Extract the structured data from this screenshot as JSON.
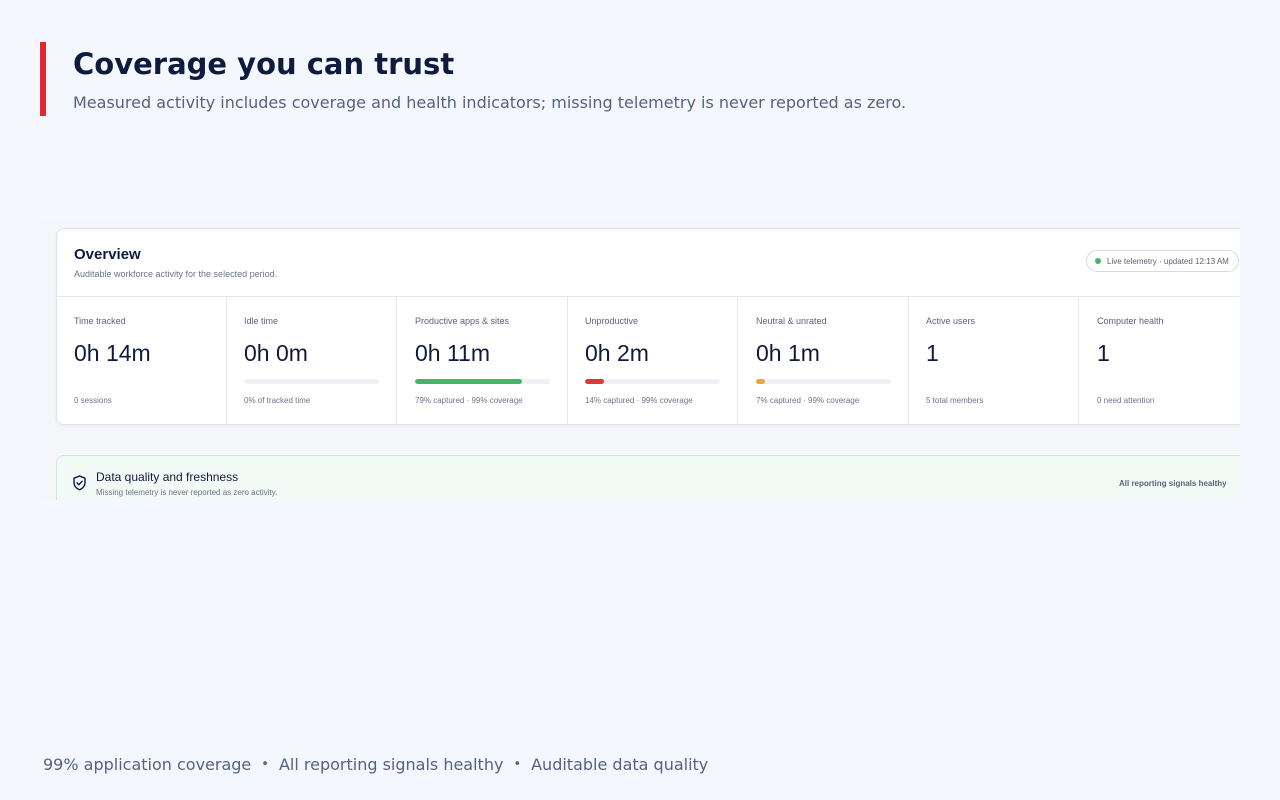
{
  "slide": {
    "headline": "Coverage you can trust",
    "subheadline": "Measured activity includes coverage and health indicators; missing telemetry is never reported as zero.",
    "accent_color": "#e3262f"
  },
  "overview": {
    "title": "Overview",
    "subtitle": "Auditable workforce activity for the selected period.",
    "live_status": "Live telemetry · updated 12:13 AM",
    "metrics": [
      {
        "label": "Time tracked",
        "value": "0h 14m",
        "footnote": "0 sessions"
      },
      {
        "label": "Idle time",
        "value": "0h 0m",
        "footnote": "0% of tracked time",
        "bar_fraction": 0.0,
        "bar_color": "#eff1f6"
      },
      {
        "label": "Productive apps & sites",
        "value": "0h 11m",
        "footnote": "79% captured · 99% coverage",
        "bar_fraction": 0.79,
        "bar_color": "#45b36b"
      },
      {
        "label": "Unproductive",
        "value": "0h 2m",
        "footnote": "14% captured · 99% coverage",
        "bar_fraction": 0.14,
        "bar_color": "#e0353d"
      },
      {
        "label": "Neutral & unrated",
        "value": "0h 1m",
        "footnote": "7% captured · 99% coverage",
        "bar_fraction": 0.07,
        "bar_color": "#e3a93b"
      },
      {
        "label": "Active users",
        "value": "1",
        "footnote": "5 total members"
      },
      {
        "label": "Computer health",
        "value": "1",
        "footnote": "0 need attention"
      }
    ]
  },
  "data_quality": {
    "title": "Data quality and freshness",
    "subtitle": "Missing telemetry is never reported as zero activity.",
    "status": "All reporting signals healthy",
    "icon": "shield-check-icon"
  },
  "footer": {
    "items": [
      "99% application coverage",
      "All reporting signals healthy",
      "Auditable data quality"
    ],
    "separator": "•"
  }
}
